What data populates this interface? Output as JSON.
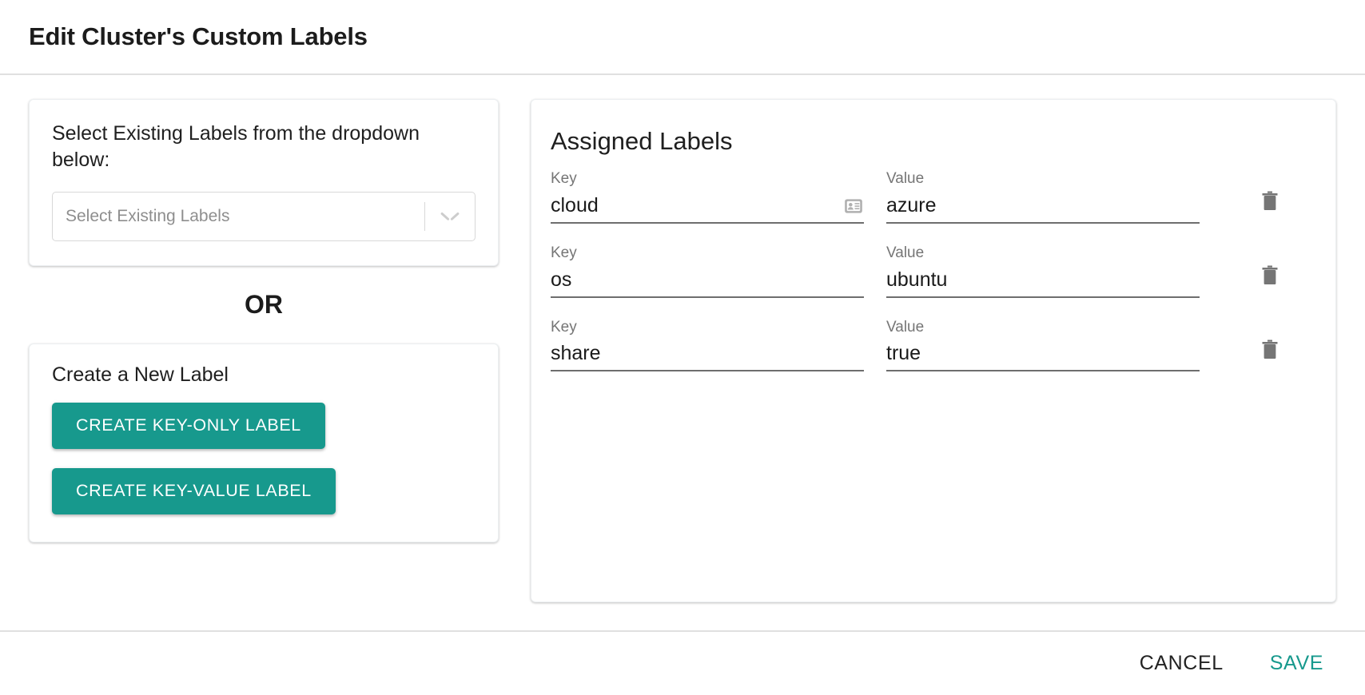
{
  "header": {
    "title": "Edit Cluster's Custom Labels"
  },
  "left_panel": {
    "select_card": {
      "instruction": "Select Existing Labels from the dropdown below:",
      "dropdown_placeholder": "Select Existing Labels",
      "dropdown_value": "",
      "chevron_icon": "chevron-down-icon"
    },
    "or_text": "OR",
    "create_card": {
      "title": "Create a New Label",
      "buttons": [
        {
          "label": "CREATE KEY-ONLY LABEL"
        },
        {
          "label": "CREATE KEY-VALUE LABEL"
        }
      ]
    }
  },
  "right_panel": {
    "title": "Assigned Labels",
    "key_caption": "Key",
    "value_caption": "Value",
    "delete_icon": "trash-icon",
    "badge_icon": "contact-card-icon",
    "rows": [
      {
        "key": "cloud",
        "value": "azure",
        "has_badge_icon": true
      },
      {
        "key": "os",
        "value": "ubuntu",
        "has_badge_icon": false
      },
      {
        "key": "share",
        "value": "true",
        "has_badge_icon": false
      }
    ]
  },
  "footer": {
    "cancel_label": "CANCEL",
    "save_label": "SAVE"
  },
  "colors": {
    "accent_teal": "#17998d",
    "text_primary": "#1f1f1f",
    "text_muted": "#757575",
    "divider": "#e0e0e0",
    "icon_gray": "#757575"
  }
}
